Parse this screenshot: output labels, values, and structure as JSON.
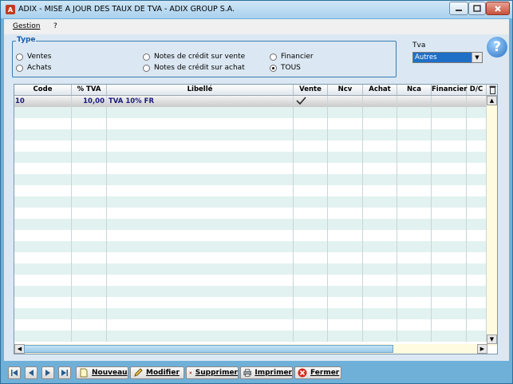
{
  "window": {
    "title": "ADIX - MISE A JOUR DES TAUX DE TVA - ADIX GROUP S.A.",
    "controls": {
      "minimize": "minimize-icon",
      "maximize": "maximize-icon",
      "close": "close-icon"
    }
  },
  "menu": {
    "items": [
      "Gestion",
      "?"
    ]
  },
  "type_group": {
    "legend": "Type",
    "options": [
      {
        "label": "Ventes",
        "selected": false
      },
      {
        "label": "Achats",
        "selected": false
      },
      {
        "label": "Notes de crédit sur vente",
        "selected": false
      },
      {
        "label": "Notes de crédit sur achat",
        "selected": false
      },
      {
        "label": "Financier",
        "selected": false
      },
      {
        "label": "TOUS",
        "selected": true
      }
    ]
  },
  "tva": {
    "label": "Tva",
    "selected": "Autres"
  },
  "help": {
    "label": "?"
  },
  "table": {
    "columns": [
      "Code",
      "% TVA",
      "Libellé",
      "Vente",
      "Ncv",
      "Achat",
      "Nca",
      "Financier",
      "D/C"
    ],
    "rows": [
      {
        "code": "10",
        "pct": "10,00",
        "libelle": "TVA 10% FR",
        "vente": true,
        "ncv": "",
        "achat": "",
        "nca": "",
        "financier": "",
        "dc": ""
      }
    ],
    "empty_rows": 21
  },
  "toolbar": {
    "nav": [
      "first-icon",
      "prev-icon",
      "next-icon",
      "last-icon"
    ],
    "buttons": [
      {
        "label": "Nouveau",
        "icon": "new-document-icon"
      },
      {
        "label": "Modifier",
        "icon": "edit-icon"
      },
      {
        "label": "Supprimer",
        "icon": "delete-icon"
      },
      {
        "label": "Imprimer",
        "icon": "printer-icon"
      },
      {
        "label": "Fermer",
        "icon": "close-circle-icon"
      }
    ]
  },
  "colors": {
    "frame": "#6fb0d9",
    "panel": "#dbe8f3",
    "row_alt": "#e2f2f0",
    "select_bg": "#1f6fc6"
  }
}
